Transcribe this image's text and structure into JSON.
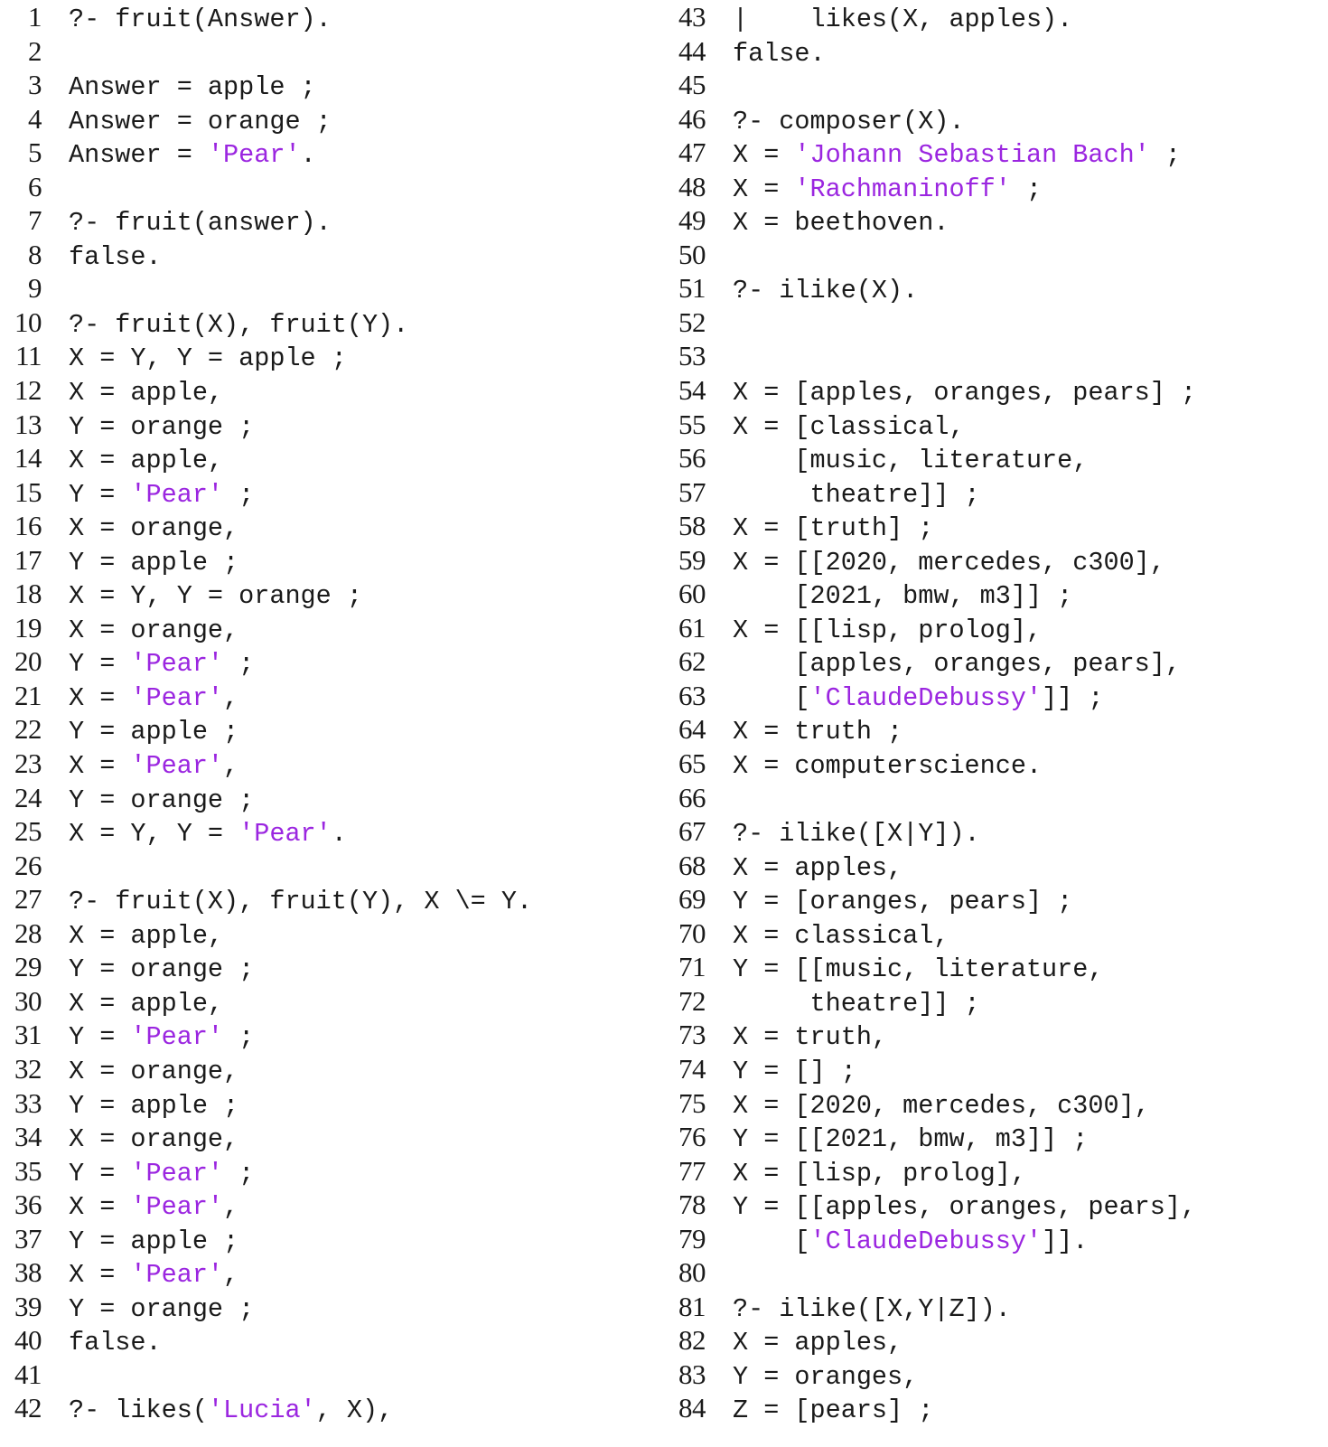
{
  "document": {
    "type": "prolog-console-transcript",
    "title": "Prolog query results listing",
    "colors": {
      "background": "#ffffff",
      "text": "#1a1a1a",
      "quoted_atom": "#9b26e0",
      "line_number": "#1a1a1a"
    },
    "line_number_range": [
      1,
      84
    ],
    "columns": [
      {
        "name": "left-column",
        "line_range": [
          1,
          42
        ],
        "lines": [
          {
            "n": "1",
            "segments": [
              {
                "t": "?- fruit(Answer).",
                "c": "plain"
              }
            ]
          },
          {
            "n": "2",
            "segments": []
          },
          {
            "n": "3",
            "segments": [
              {
                "t": "Answer = apple ;",
                "c": "plain"
              }
            ]
          },
          {
            "n": "4",
            "segments": [
              {
                "t": "Answer = orange ;",
                "c": "plain"
              }
            ]
          },
          {
            "n": "5",
            "segments": [
              {
                "t": "Answer = ",
                "c": "plain"
              },
              {
                "t": "'Pear'",
                "c": "str"
              },
              {
                "t": ".",
                "c": "plain"
              }
            ]
          },
          {
            "n": "6",
            "segments": []
          },
          {
            "n": "7",
            "segments": [
              {
                "t": "?- fruit(answer).",
                "c": "plain"
              }
            ]
          },
          {
            "n": "8",
            "segments": [
              {
                "t": "false.",
                "c": "plain"
              }
            ]
          },
          {
            "n": "9",
            "segments": []
          },
          {
            "n": "10",
            "segments": [
              {
                "t": "?- fruit(X), fruit(Y).",
                "c": "plain"
              }
            ]
          },
          {
            "n": "11",
            "segments": [
              {
                "t": "X = Y, Y = apple ;",
                "c": "plain"
              }
            ]
          },
          {
            "n": "12",
            "segments": [
              {
                "t": "X = apple,",
                "c": "plain"
              }
            ]
          },
          {
            "n": "13",
            "segments": [
              {
                "t": "Y = orange ;",
                "c": "plain"
              }
            ]
          },
          {
            "n": "14",
            "segments": [
              {
                "t": "X = apple,",
                "c": "plain"
              }
            ]
          },
          {
            "n": "15",
            "segments": [
              {
                "t": "Y = ",
                "c": "plain"
              },
              {
                "t": "'Pear'",
                "c": "str"
              },
              {
                "t": " ;",
                "c": "plain"
              }
            ]
          },
          {
            "n": "16",
            "segments": [
              {
                "t": "X = orange,",
                "c": "plain"
              }
            ]
          },
          {
            "n": "17",
            "segments": [
              {
                "t": "Y = apple ;",
                "c": "plain"
              }
            ]
          },
          {
            "n": "18",
            "segments": [
              {
                "t": "X = Y, Y = orange ;",
                "c": "plain"
              }
            ]
          },
          {
            "n": "19",
            "segments": [
              {
                "t": "X = orange,",
                "c": "plain"
              }
            ]
          },
          {
            "n": "20",
            "segments": [
              {
                "t": "Y = ",
                "c": "plain"
              },
              {
                "t": "'Pear'",
                "c": "str"
              },
              {
                "t": " ;",
                "c": "plain"
              }
            ]
          },
          {
            "n": "21",
            "segments": [
              {
                "t": "X = ",
                "c": "plain"
              },
              {
                "t": "'Pear'",
                "c": "str"
              },
              {
                "t": ",",
                "c": "plain"
              }
            ]
          },
          {
            "n": "22",
            "segments": [
              {
                "t": "Y = apple ;",
                "c": "plain"
              }
            ]
          },
          {
            "n": "23",
            "segments": [
              {
                "t": "X = ",
                "c": "plain"
              },
              {
                "t": "'Pear'",
                "c": "str"
              },
              {
                "t": ",",
                "c": "plain"
              }
            ]
          },
          {
            "n": "24",
            "segments": [
              {
                "t": "Y = orange ;",
                "c": "plain"
              }
            ]
          },
          {
            "n": "25",
            "segments": [
              {
                "t": "X = Y, Y = ",
                "c": "plain"
              },
              {
                "t": "'Pear'",
                "c": "str"
              },
              {
                "t": ".",
                "c": "plain"
              }
            ]
          },
          {
            "n": "26",
            "segments": []
          },
          {
            "n": "27",
            "segments": [
              {
                "t": "?- fruit(X), fruit(Y), X \\= Y.",
                "c": "plain"
              }
            ]
          },
          {
            "n": "28",
            "segments": [
              {
                "t": "X = apple,",
                "c": "plain"
              }
            ]
          },
          {
            "n": "29",
            "segments": [
              {
                "t": "Y = orange ;",
                "c": "plain"
              }
            ]
          },
          {
            "n": "30",
            "segments": [
              {
                "t": "X = apple,",
                "c": "plain"
              }
            ]
          },
          {
            "n": "31",
            "segments": [
              {
                "t": "Y = ",
                "c": "plain"
              },
              {
                "t": "'Pear'",
                "c": "str"
              },
              {
                "t": " ;",
                "c": "plain"
              }
            ]
          },
          {
            "n": "32",
            "segments": [
              {
                "t": "X = orange,",
                "c": "plain"
              }
            ]
          },
          {
            "n": "33",
            "segments": [
              {
                "t": "Y = apple ;",
                "c": "plain"
              }
            ]
          },
          {
            "n": "34",
            "segments": [
              {
                "t": "X = orange,",
                "c": "plain"
              }
            ]
          },
          {
            "n": "35",
            "segments": [
              {
                "t": "Y = ",
                "c": "plain"
              },
              {
                "t": "'Pear'",
                "c": "str"
              },
              {
                "t": " ;",
                "c": "plain"
              }
            ]
          },
          {
            "n": "36",
            "segments": [
              {
                "t": "X = ",
                "c": "plain"
              },
              {
                "t": "'Pear'",
                "c": "str"
              },
              {
                "t": ",",
                "c": "plain"
              }
            ]
          },
          {
            "n": "37",
            "segments": [
              {
                "t": "Y = apple ;",
                "c": "plain"
              }
            ]
          },
          {
            "n": "38",
            "segments": [
              {
                "t": "X = ",
                "c": "plain"
              },
              {
                "t": "'Pear'",
                "c": "str"
              },
              {
                "t": ",",
                "c": "plain"
              }
            ]
          },
          {
            "n": "39",
            "segments": [
              {
                "t": "Y = orange ;",
                "c": "plain"
              }
            ]
          },
          {
            "n": "40",
            "segments": [
              {
                "t": "false.",
                "c": "plain"
              }
            ]
          },
          {
            "n": "41",
            "segments": []
          },
          {
            "n": "42",
            "segments": [
              {
                "t": "?- likes(",
                "c": "plain"
              },
              {
                "t": "'Lucia'",
                "c": "str"
              },
              {
                "t": ", X),",
                "c": "plain"
              }
            ]
          }
        ]
      },
      {
        "name": "right-column",
        "line_range": [
          43,
          84
        ],
        "lines": [
          {
            "n": "43",
            "segments": [
              {
                "t": "|    likes(X, apples).",
                "c": "plain"
              }
            ]
          },
          {
            "n": "44",
            "segments": [
              {
                "t": "false.",
                "c": "plain"
              }
            ]
          },
          {
            "n": "45",
            "segments": []
          },
          {
            "n": "46",
            "segments": [
              {
                "t": "?- composer(X).",
                "c": "plain"
              }
            ]
          },
          {
            "n": "47",
            "segments": [
              {
                "t": "X = ",
                "c": "plain"
              },
              {
                "t": "'Johann Sebastian Bach'",
                "c": "str"
              },
              {
                "t": " ;",
                "c": "plain"
              }
            ]
          },
          {
            "n": "48",
            "segments": [
              {
                "t": "X = ",
                "c": "plain"
              },
              {
                "t": "'Rachmaninoff'",
                "c": "str"
              },
              {
                "t": " ;",
                "c": "plain"
              }
            ]
          },
          {
            "n": "49",
            "segments": [
              {
                "t": "X = beethoven.",
                "c": "plain"
              }
            ]
          },
          {
            "n": "50",
            "segments": []
          },
          {
            "n": "51",
            "segments": [
              {
                "t": "?- ilike(X).",
                "c": "plain"
              }
            ]
          },
          {
            "n": "52",
            "segments": []
          },
          {
            "n": "53",
            "segments": []
          },
          {
            "n": "54",
            "segments": [
              {
                "t": "X = [apples, oranges, pears] ;",
                "c": "plain"
              }
            ]
          },
          {
            "n": "55",
            "segments": [
              {
                "t": "X = [classical,",
                "c": "plain"
              }
            ]
          },
          {
            "n": "56",
            "segments": [
              {
                "t": "    [music, literature,",
                "c": "plain"
              }
            ]
          },
          {
            "n": "57",
            "segments": [
              {
                "t": "     theatre]] ;",
                "c": "plain"
              }
            ]
          },
          {
            "n": "58",
            "segments": [
              {
                "t": "X = [truth] ;",
                "c": "plain"
              }
            ]
          },
          {
            "n": "59",
            "segments": [
              {
                "t": "X = [[2020, mercedes, c300],",
                "c": "plain"
              }
            ]
          },
          {
            "n": "60",
            "segments": [
              {
                "t": "    [2021, bmw, m3]] ;",
                "c": "plain"
              }
            ]
          },
          {
            "n": "61",
            "segments": [
              {
                "t": "X = [[lisp, prolog],",
                "c": "plain"
              }
            ]
          },
          {
            "n": "62",
            "segments": [
              {
                "t": "    [apples, oranges, pears],",
                "c": "plain"
              }
            ]
          },
          {
            "n": "63",
            "segments": [
              {
                "t": "    [",
                "c": "plain"
              },
              {
                "t": "'ClaudeDebussy'",
                "c": "str"
              },
              {
                "t": "]] ;",
                "c": "plain"
              }
            ]
          },
          {
            "n": "64",
            "segments": [
              {
                "t": "X = truth ;",
                "c": "plain"
              }
            ]
          },
          {
            "n": "65",
            "segments": [
              {
                "t": "X = computerscience.",
                "c": "plain"
              }
            ]
          },
          {
            "n": "66",
            "segments": []
          },
          {
            "n": "67",
            "segments": [
              {
                "t": "?- ilike([X|Y]).",
                "c": "plain"
              }
            ]
          },
          {
            "n": "68",
            "segments": [
              {
                "t": "X = apples,",
                "c": "plain"
              }
            ]
          },
          {
            "n": "69",
            "segments": [
              {
                "t": "Y = [oranges, pears] ;",
                "c": "plain"
              }
            ]
          },
          {
            "n": "70",
            "segments": [
              {
                "t": "X = classical,",
                "c": "plain"
              }
            ]
          },
          {
            "n": "71",
            "segments": [
              {
                "t": "Y = [[music, literature,",
                "c": "plain"
              }
            ]
          },
          {
            "n": "72",
            "segments": [
              {
                "t": "     theatre]] ;",
                "c": "plain"
              }
            ]
          },
          {
            "n": "73",
            "segments": [
              {
                "t": "X = truth,",
                "c": "plain"
              }
            ]
          },
          {
            "n": "74",
            "segments": [
              {
                "t": "Y = [] ;",
                "c": "plain"
              }
            ]
          },
          {
            "n": "75",
            "segments": [
              {
                "t": "X = [2020, mercedes, c300],",
                "c": "plain"
              }
            ]
          },
          {
            "n": "76",
            "segments": [
              {
                "t": "Y = [[2021, bmw, m3]] ;",
                "c": "plain"
              }
            ]
          },
          {
            "n": "77",
            "segments": [
              {
                "t": "X = [lisp, prolog],",
                "c": "plain"
              }
            ]
          },
          {
            "n": "78",
            "segments": [
              {
                "t": "Y = [[apples, oranges, pears],",
                "c": "plain"
              }
            ]
          },
          {
            "n": "79",
            "segments": [
              {
                "t": "    [",
                "c": "plain"
              },
              {
                "t": "'ClaudeDebussy'",
                "c": "str"
              },
              {
                "t": "]].",
                "c": "plain"
              }
            ]
          },
          {
            "n": "80",
            "segments": []
          },
          {
            "n": "81",
            "segments": [
              {
                "t": "?- ilike([X,Y|Z]).",
                "c": "plain"
              }
            ]
          },
          {
            "n": "82",
            "segments": [
              {
                "t": "X = apples,",
                "c": "plain"
              }
            ]
          },
          {
            "n": "83",
            "segments": [
              {
                "t": "Y = oranges,",
                "c": "plain"
              }
            ]
          },
          {
            "n": "84",
            "segments": [
              {
                "t": "Z = [pears] ;",
                "c": "plain"
              }
            ]
          }
        ]
      }
    ]
  }
}
